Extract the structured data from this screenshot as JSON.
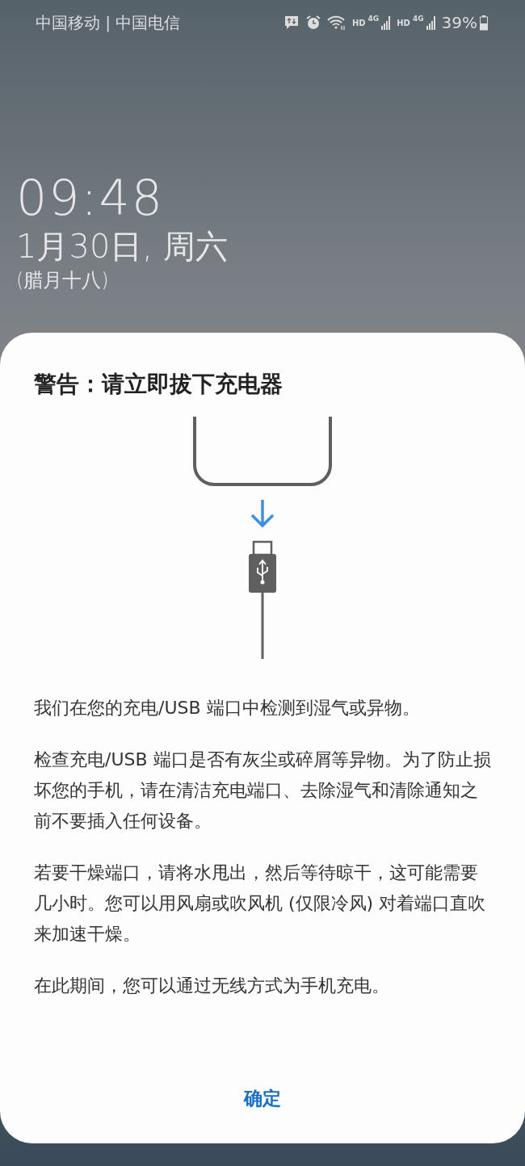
{
  "status_bar": {
    "carriers": "中国移动 | 中国电信",
    "sims": [
      {
        "hd": "HD",
        "network": "4G"
      },
      {
        "hd": "HD",
        "network": "4G"
      }
    ],
    "battery": "39%"
  },
  "lock_screen": {
    "time": "09:48",
    "date": "1月30日, 周六",
    "lunar_date": "(腊月十八)"
  },
  "dialog": {
    "title": "警告：请立即拔下充电器",
    "paragraphs": [
      "我们在您的充电/USB 端口中检测到湿气或异物。",
      "检查充电/USB 端口是否有灰尘或碎屑等异物。为了防止损坏您的手机，请在清洁充电端口、去除湿气和清除通知之前不要插入任何设备。",
      "若要干燥端口，请将水甩出，然后等待晾干，这可能需要几小时。您可以用风扇或吹风机 (仅限冷风) 对着端口直吹来加速干燥。",
      "在此期间，您可以通过无线方式为手机充电。"
    ],
    "button": "确定"
  }
}
